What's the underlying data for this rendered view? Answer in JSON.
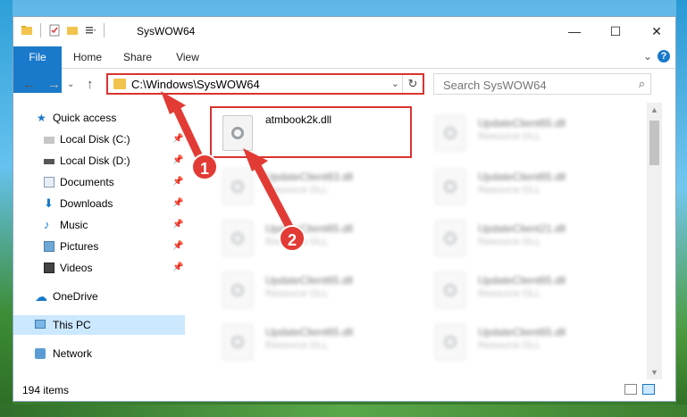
{
  "window": {
    "title": "SysWOW64",
    "controls": {
      "minimize": "—",
      "maximize": "☐",
      "close": "✕"
    }
  },
  "ribbon": {
    "tabs": [
      "File",
      "Home",
      "Share",
      "View"
    ],
    "help": "?"
  },
  "address": {
    "path": "C:\\Windows\\SysWOW64",
    "search_placeholder": "Search SysWOW64"
  },
  "nav": {
    "quick_access": "Quick access",
    "items": [
      {
        "label": "Local Disk (C:)",
        "icon": "drive-icon"
      },
      {
        "label": "Local Disk (D:)",
        "icon": "drive-icon"
      },
      {
        "label": "Documents",
        "icon": "documents-icon"
      },
      {
        "label": "Downloads",
        "icon": "downloads-icon"
      },
      {
        "label": "Music",
        "icon": "music-icon"
      },
      {
        "label": "Pictures",
        "icon": "pictures-icon"
      },
      {
        "label": "Videos",
        "icon": "videos-icon"
      }
    ],
    "onedrive": "OneDrive",
    "this_pc": "This PC",
    "network": "Network"
  },
  "files": {
    "highlighted": {
      "name": "atmbook2k.dll"
    },
    "left_column": [
      {
        "name": "UpdateClient63.dll",
        "type": "Resource DLL"
      },
      {
        "name": "UpdateClient65.dll",
        "type": "Resource DLL"
      },
      {
        "name": "UpdateClient65.dll",
        "type": "Resource DLL"
      },
      {
        "name": "UpdateClient65.dll",
        "type": "Resource DLL"
      }
    ],
    "right_column": [
      {
        "name": "UpdateClient65.dll",
        "type": "Resource DLL"
      },
      {
        "name": "UpdateClient65.dll",
        "type": "Resource DLL"
      },
      {
        "name": "UpdateClient21.dll",
        "type": "Resource DLL"
      },
      {
        "name": "UpdateClient65.dll",
        "type": "Resource DLL"
      },
      {
        "name": "UpdateClient65.dll",
        "type": "Resource DLL"
      }
    ]
  },
  "status": {
    "item_count": "194 items"
  },
  "annotations": {
    "step1": "1",
    "step2": "2",
    "color": "#e23b35"
  }
}
